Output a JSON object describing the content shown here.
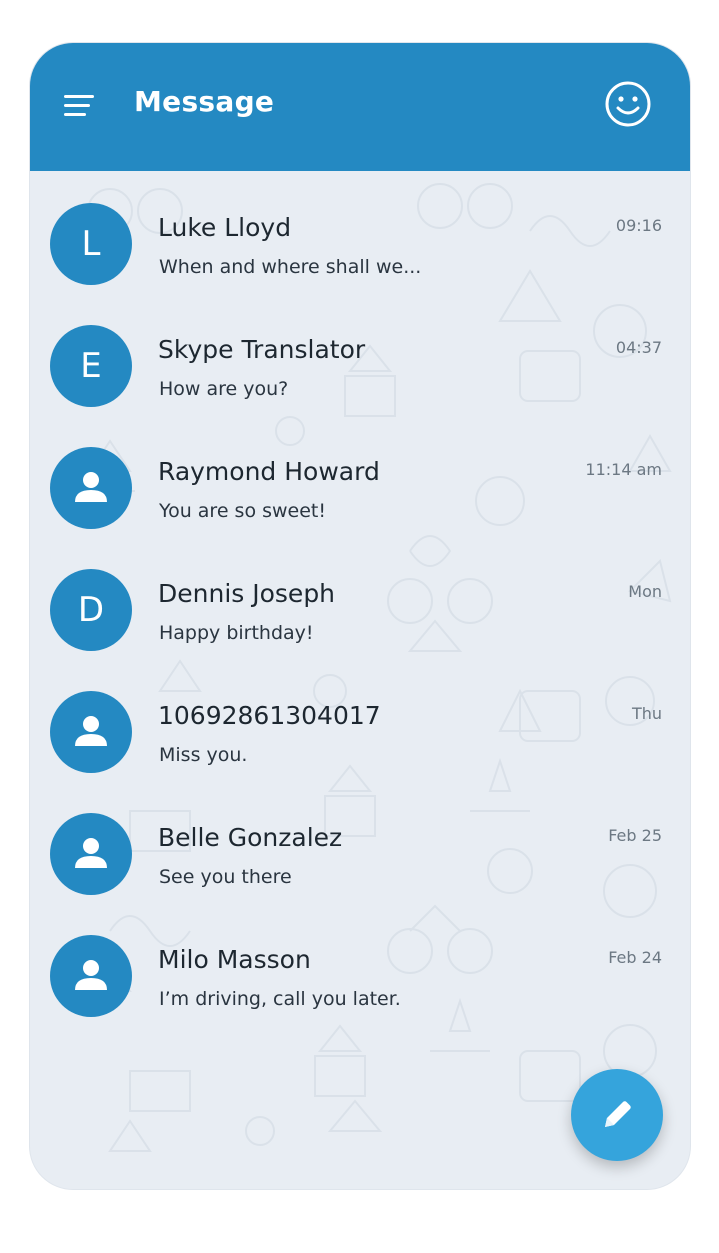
{
  "header": {
    "title": "Message",
    "menu_icon": "hamburger-menu-icon",
    "profile_icon": "smiley-face-icon",
    "background_color": "#2489c2"
  },
  "conversations": [
    {
      "avatar": "L",
      "avatar_type": "initial",
      "name": "Luke Lloyd",
      "preview": "When and where shall we...",
      "time": "09:16"
    },
    {
      "avatar": "E",
      "avatar_type": "initial",
      "name": "Skype Translator",
      "preview": "How are you?",
      "time": "04:37"
    },
    {
      "avatar": "",
      "avatar_type": "person-icon",
      "name": "Raymond Howard",
      "preview": "You are so sweet!",
      "time": "11:14 am"
    },
    {
      "avatar": "D",
      "avatar_type": "initial",
      "name": "Dennis Joseph",
      "preview": "Happy birthday!",
      "time": "Mon"
    },
    {
      "avatar": "",
      "avatar_type": "person-icon",
      "name": "10692861304017",
      "preview": "Miss you.",
      "time": "Thu"
    },
    {
      "avatar": "",
      "avatar_type": "person-icon",
      "name": "Belle Gonzalez",
      "preview": "See you there",
      "time": "Feb 25"
    },
    {
      "avatar": "",
      "avatar_type": "person-icon",
      "name": "Milo Masson",
      "preview": "I’m driving, call you later.",
      "time": "Feb 24"
    }
  ],
  "fab": {
    "icon": "pencil-compose-icon",
    "color": "#35a4dc"
  },
  "colors": {
    "accent": "#2489c2",
    "background": "#e8edf3"
  }
}
